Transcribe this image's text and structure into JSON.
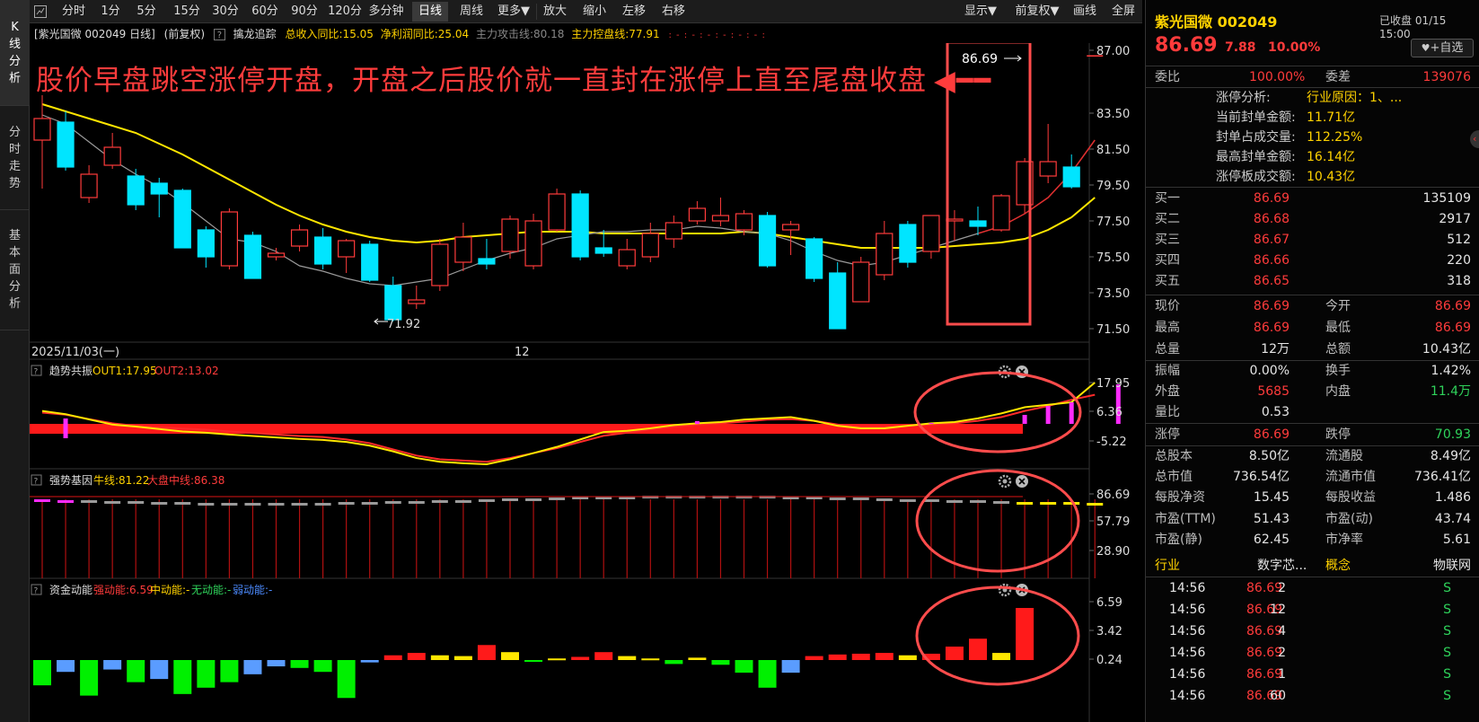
{
  "vnav": [
    {
      "label": "K线分析",
      "chars": [
        "K",
        "线",
        "分",
        "析"
      ],
      "active": true
    },
    {
      "label": "分时走势",
      "chars": [
        "分",
        "时",
        "走",
        "势"
      ],
      "active": false
    },
    {
      "label": "基本面分析",
      "chars": [
        "基",
        "本",
        "面",
        "分",
        "析"
      ],
      "active": false
    }
  ],
  "toolbar": {
    "periods": [
      "分时",
      "1分",
      "5分",
      "15分",
      "30分",
      "60分",
      "90分",
      "120分",
      "多分钟",
      "日线",
      "周线",
      "更多▼"
    ],
    "active_period": "日线",
    "tools": [
      "放大",
      "缩小",
      "左移",
      "右移"
    ],
    "right": [
      "显示▼",
      "前复权▼",
      "画线",
      "全屏"
    ]
  },
  "info": {
    "stock": "[紫光国微 002049 日线]",
    "adjust": "(前复权)",
    "indicator_name": "擒龙追踪",
    "total_income": "总收入同比:15.05",
    "net_profit": "净利润同比:25.04",
    "attack_line": "主力攻击线:80.18",
    "control_line": "主力控盘线:77.91",
    "marks": ": - : - : - : - : - : - :"
  },
  "annotation": {
    "text": "股价早盘跳空涨停开盘，开盘之后股价就一直封在涨停上直至尾盘收盘",
    "arrow": "◀━━"
  },
  "main_chart": {
    "high_label": "86.69",
    "low_label": "71.92",
    "date_left": "2025/11/03(一)",
    "date_mid": "12",
    "y_ticks": [
      "87.00",
      "83.50",
      "81.50",
      "79.50",
      "77.50",
      "75.50",
      "73.50",
      "71.50"
    ]
  },
  "panel1": {
    "name": "趋势共振",
    "out1": "OUT1:17.95",
    "out2": "OUT2:13.02",
    "y_ticks": [
      "17.95",
      "6.36",
      "-5.22"
    ]
  },
  "panel2": {
    "name": "强势基因",
    "bull": "牛线:81.22",
    "market": "大盘中线:86.38",
    "y_ticks": [
      "86.69",
      "57.79",
      "28.90"
    ]
  },
  "panel3": {
    "name": "资金动能",
    "strong": "强动能:6.59",
    "mid": "中动能:-",
    "none": "无动能:-",
    "weak": "弱动能:-",
    "y_ticks": [
      "6.59",
      "3.42",
      "0.24"
    ]
  },
  "chart_data": {
    "type": "candlestick",
    "start_date": "2025/11/03",
    "candles": [
      [
        82.0,
        83.2,
        84.5,
        79.3
      ],
      [
        83.0,
        80.5,
        83.6,
        80.3
      ],
      [
        78.8,
        80.1,
        80.6,
        78.5
      ],
      [
        80.6,
        81.6,
        82.4,
        80.4
      ],
      [
        80.0,
        78.4,
        80.4,
        78.1
      ],
      [
        79.6,
        79.0,
        79.9,
        77.7
      ],
      [
        79.2,
        76.0,
        79.3,
        76.0
      ],
      [
        77.0,
        75.5,
        77.2,
        74.9
      ],
      [
        75.0,
        78.0,
        78.2,
        74.8
      ],
      [
        76.7,
        74.3,
        76.9,
        74.3
      ],
      [
        75.5,
        75.7,
        76.0,
        75.3
      ],
      [
        76.1,
        77.0,
        77.3,
        75.8
      ],
      [
        76.6,
        75.1,
        77.1,
        74.8
      ],
      [
        75.5,
        76.4,
        76.5,
        74.6
      ],
      [
        76.2,
        74.2,
        76.4,
        74.1
      ],
      [
        73.9,
        72.0,
        74.4,
        71.9
      ],
      [
        72.9,
        73.1,
        73.9,
        72.6
      ],
      [
        73.9,
        76.2,
        76.5,
        73.6
      ],
      [
        75.2,
        76.6,
        77.4,
        74.7
      ],
      [
        75.4,
        75.1,
        76.5,
        74.8
      ],
      [
        75.8,
        77.6,
        77.8,
        75.4
      ],
      [
        75.0,
        77.5,
        77.9,
        74.8
      ],
      [
        77.0,
        79.0,
        79.3,
        76.9
      ],
      [
        79.0,
        75.5,
        79.2,
        75.3
      ],
      [
        76.0,
        75.7,
        77.0,
        75.5
      ],
      [
        75.0,
        75.9,
        76.5,
        74.8
      ],
      [
        75.5,
        76.8,
        77.4,
        75.2
      ],
      [
        76.5,
        77.4,
        77.8,
        76.0
      ],
      [
        77.5,
        78.2,
        78.6,
        77.3
      ],
      [
        77.5,
        77.8,
        78.8,
        77.2
      ],
      [
        77.0,
        77.9,
        78.1,
        76.7
      ],
      [
        77.8,
        75.0,
        78.0,
        74.9
      ],
      [
        77.0,
        77.3,
        77.5,
        75.6
      ],
      [
        76.5,
        74.3,
        76.6,
        74.1
      ],
      [
        74.6,
        71.5,
        75.2,
        71.5
      ],
      [
        73.0,
        75.2,
        75.5,
        73.0
      ],
      [
        74.5,
        76.8,
        77.5,
        74.2
      ],
      [
        77.3,
        75.2,
        77.5,
        74.9
      ],
      [
        75.8,
        77.8,
        77.8,
        75.4
      ],
      [
        77.5,
        77.6,
        78.1,
        76.4
      ],
      [
        77.5,
        77.2,
        78.3,
        76.7
      ],
      [
        77.0,
        78.9,
        79.0,
        76.9
      ],
      [
        78.4,
        80.8,
        81.0,
        77.9
      ],
      [
        80.0,
        80.8,
        82.9,
        79.6
      ],
      [
        80.5,
        79.4,
        81.2,
        79.3
      ]
    ],
    "ma5": [
      83.4,
      82.9,
      81.9,
      80.9,
      80.1,
      79.4,
      78.5,
      77.5,
      76.5,
      76.3,
      75.8,
      75.0,
      74.7,
      74.3,
      74.0,
      73.9,
      74.1,
      74.3,
      74.8,
      75.3,
      75.7,
      76.0,
      76.5,
      76.7,
      76.9,
      76.9,
      77.0,
      77.0,
      77.2,
      77.1,
      76.9,
      76.8,
      76.4,
      75.8,
      75.3,
      75.0,
      75.2,
      75.6,
      76.0,
      76.4,
      76.8,
      77.2,
      77.9,
      78.8,
      80.2
    ],
    "ma20": [
      84.0,
      83.6,
      83.2,
      82.8,
      82.4,
      81.8,
      81.2,
      80.5,
      79.8,
      79.1,
      78.4,
      77.8,
      77.3,
      76.9,
      76.6,
      76.4,
      76.3,
      76.4,
      76.6,
      76.7,
      76.8,
      76.9,
      76.9,
      76.9,
      76.8,
      76.8,
      76.8,
      76.8,
      76.8,
      76.8,
      76.9,
      76.8,
      76.6,
      76.4,
      76.2,
      76.0,
      76.0,
      76.0,
      76.0,
      76.1,
      76.2,
      76.3,
      76.5,
      77.0,
      77.7
    ],
    "panel1_yellow": [
      6.5,
      5.2,
      3.1,
      1.0,
      0.2,
      -0.8,
      -1.8,
      -2.3,
      -3.0,
      -3.6,
      -4.2,
      -4.8,
      -5.2,
      -6.0,
      -7.5,
      -9.8,
      -12.5,
      -14.0,
      -14.6,
      -15.0,
      -13.0,
      -10.5,
      -8.0,
      -5.0,
      -2.0,
      -1.5,
      -0.5,
      0.8,
      1.5,
      2.0,
      3.0,
      3.5,
      4.0,
      2.5,
      0.5,
      -0.5,
      -0.5,
      0.5,
      1.5,
      2.0,
      3.5,
      5.5,
      8.0,
      9.0,
      10.0,
      17.95
    ],
    "panel1_red": [
      5.8,
      5.0,
      3.2,
      1.5,
      0.5,
      -0.2,
      -0.6,
      -1.0,
      -1.8,
      -2.4,
      -3.0,
      -3.6,
      -4.0,
      -5.0,
      -6.5,
      -9.0,
      -11.5,
      -13.0,
      -13.5,
      -14.0,
      -12.5,
      -10.5,
      -8.5,
      -6.0,
      -3.5,
      -2.3,
      -1.0,
      0.2,
      1.0,
      1.5,
      2.2,
      3.0,
      3.2,
      2.5,
      1.0,
      0.0,
      0.0,
      0.5,
      1.0,
      1.5,
      2.5,
      4.0,
      6.5,
      8.5,
      11.0,
      13.02
    ],
    "panel3_bars": [
      [
        -3.2,
        "g"
      ],
      [
        -1.5,
        "b"
      ],
      [
        -4.5,
        "g"
      ],
      [
        -1.2,
        "b"
      ],
      [
        -2.8,
        "g"
      ],
      [
        -2.4,
        "b"
      ],
      [
        -4.3,
        "g"
      ],
      [
        -3.5,
        "g"
      ],
      [
        -2.8,
        "g"
      ],
      [
        -1.8,
        "b"
      ],
      [
        -0.8,
        "b"
      ],
      [
        -1.0,
        "g"
      ],
      [
        -1.5,
        "g"
      ],
      [
        -4.8,
        "g"
      ],
      [
        -0.3,
        "b"
      ],
      [
        0.6,
        "r"
      ],
      [
        0.9,
        "r"
      ],
      [
        0.6,
        "y"
      ],
      [
        0.5,
        "y"
      ],
      [
        1.9,
        "r"
      ],
      [
        1.0,
        "y"
      ],
      [
        -0.2,
        "g"
      ],
      [
        0.2,
        "y"
      ],
      [
        0.4,
        "r"
      ],
      [
        1.0,
        "r"
      ],
      [
        0.5,
        "y"
      ],
      [
        0.2,
        "y"
      ],
      [
        -0.5,
        "g"
      ],
      [
        0.3,
        "y"
      ],
      [
        -0.6,
        "g"
      ],
      [
        -1.6,
        "g"
      ],
      [
        -3.5,
        "g"
      ],
      [
        -1.6,
        "b"
      ],
      [
        0.5,
        "r"
      ],
      [
        0.7,
        "r"
      ],
      [
        0.8,
        "r"
      ],
      [
        0.9,
        "r"
      ],
      [
        0.6,
        "y"
      ],
      [
        0.8,
        "r"
      ],
      [
        1.7,
        "r"
      ],
      [
        2.7,
        "r"
      ],
      [
        0.9,
        "y"
      ],
      [
        6.59,
        "r"
      ]
    ]
  },
  "quote": {
    "title": "紫光国微 002049",
    "status": "已收盘 01/15 15:00",
    "price": "86.69",
    "change": "7.88",
    "pct": "10.00%",
    "add_button": "+自选",
    "wei_bi_label": "委比",
    "wei_bi": "100.00%",
    "wei_cha_label": "委差",
    "wei_cha": "139076",
    "limit": [
      {
        "label": "涨停分析:",
        "value": "行业原因：1、..."
      },
      {
        "label": "当前封单金额:",
        "value": "11.71亿"
      },
      {
        "label": "封单占成交量:",
        "value": "112.25%"
      },
      {
        "label": "最高封单金额:",
        "value": "16.14亿"
      },
      {
        "label": "涨停板成交额:",
        "value": "10.43亿"
      }
    ],
    "bids": [
      {
        "label": "买一",
        "price": "86.69",
        "vol": "135109"
      },
      {
        "label": "买二",
        "price": "86.68",
        "vol": "2917"
      },
      {
        "label": "买三",
        "price": "86.67",
        "vol": "512"
      },
      {
        "label": "买四",
        "price": "86.66",
        "vol": "220"
      },
      {
        "label": "买五",
        "price": "86.65",
        "vol": "318"
      }
    ],
    "stats1": [
      [
        "现价",
        "86.69",
        "今开",
        "86.69"
      ],
      [
        "最高",
        "86.69",
        "最低",
        "86.69"
      ],
      [
        "总量",
        "12万",
        "总额",
        "10.43亿"
      ]
    ],
    "stats2": [
      [
        "振幅",
        "0.00%",
        "换手",
        "1.42%"
      ],
      [
        "外盘",
        "5685",
        "内盘",
        "11.4万"
      ],
      [
        "量比",
        "0.53",
        "",
        ""
      ]
    ],
    "limits": [
      "涨停",
      "86.69",
      "跌停",
      "70.93"
    ],
    "fund": [
      [
        "总股本",
        "8.50亿",
        "流通股",
        "8.49亿"
      ],
      [
        "总市值",
        "736.54亿",
        "流通市值",
        "736.41亿"
      ],
      [
        "每股净资",
        "15.45",
        "每股收益",
        "1.486"
      ],
      [
        "市盈(TTM)",
        "51.43",
        "市盈(动)",
        "43.74"
      ],
      [
        "市盈(静)",
        "62.45",
        "市净率",
        "5.61"
      ]
    ],
    "industry": [
      "行业",
      "数字芯...",
      "概念",
      "物联网"
    ],
    "ticks": [
      [
        "14:56",
        "86.69",
        "2",
        "S"
      ],
      [
        "14:56",
        "86.69",
        "12",
        "S"
      ],
      [
        "14:56",
        "86.69",
        "4",
        "S"
      ],
      [
        "14:56",
        "86.69",
        "2",
        "S"
      ],
      [
        "14:56",
        "86.69",
        "1",
        "S"
      ],
      [
        "14:56",
        "86.69",
        "60",
        "S"
      ]
    ]
  }
}
